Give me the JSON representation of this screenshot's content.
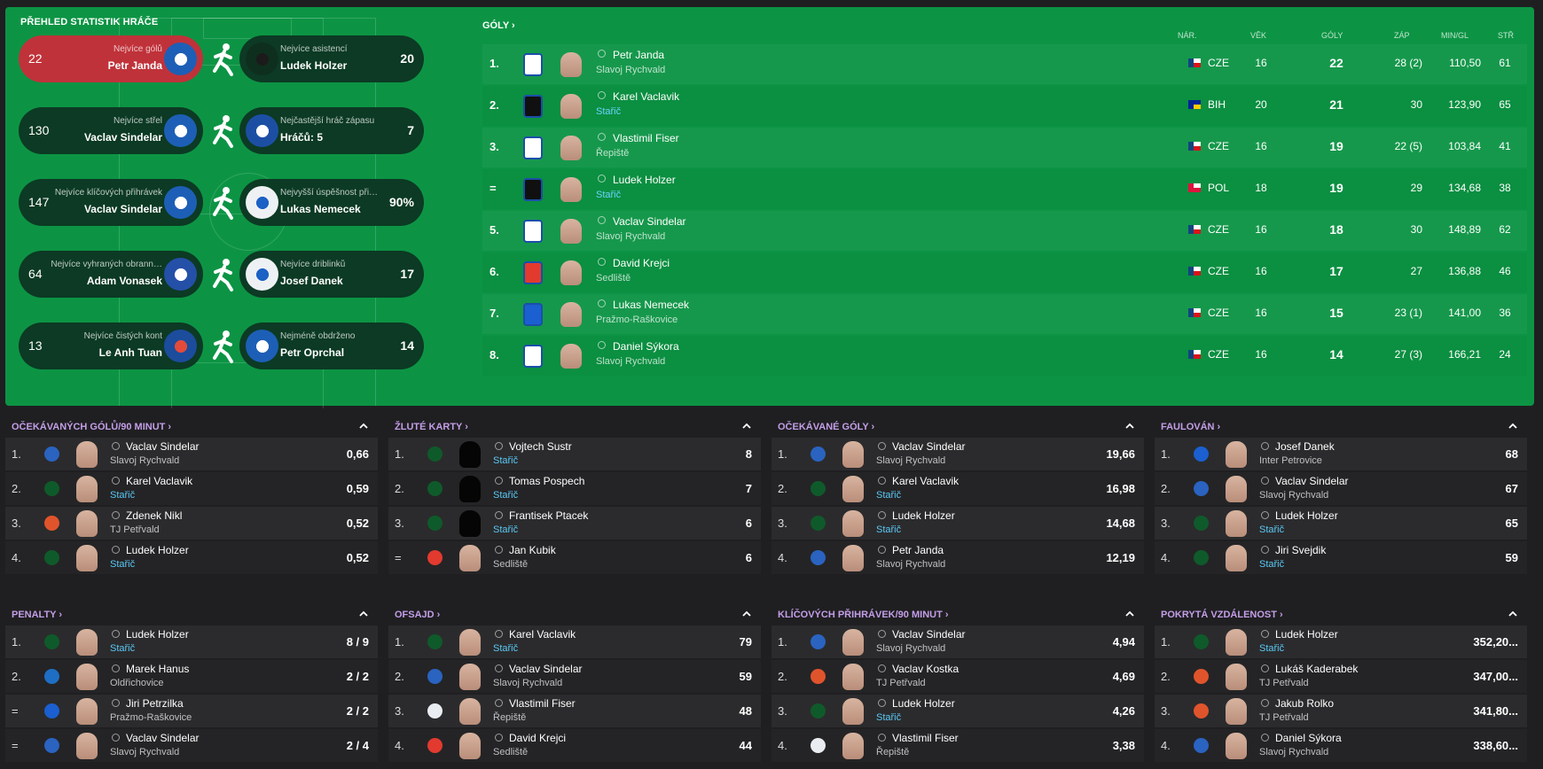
{
  "overview": {
    "title": "PŘEHLED STATISTIK HRÁČE",
    "left": [
      {
        "value": "22",
        "label": "Nejvíce gólů",
        "name": "Petr Janda",
        "highlight": true
      },
      {
        "value": "130",
        "label": "Nejvíce střel",
        "name": "Vaclav Sindelar"
      },
      {
        "value": "147",
        "label": "Nejvíce klíčových přihrávek",
        "name": "Vaclav Sindelar"
      },
      {
        "value": "64",
        "label": "Nejvíce vyhraných obrann…",
        "name": "Adam Vonasek"
      },
      {
        "value": "13",
        "label": "Nejvíce čistých kont",
        "name": "Le Anh Tuan"
      }
    ],
    "right": [
      {
        "value": "20",
        "label": "Nejvíce asistencí",
        "name": "Ludek Holzer"
      },
      {
        "value": "7",
        "label": "Nejčastější hráč zápasu",
        "name": "Hráčů: 5"
      },
      {
        "value": "90%",
        "label": "Nejvyšší úspěšnost při…",
        "name": "Lukas Nemecek"
      },
      {
        "value": "17",
        "label": "Nejvíce driblinků",
        "name": "Josef Danek"
      },
      {
        "value": "14",
        "label": "Nejméně obdrženo",
        "name": "Petr Oprchal"
      }
    ]
  },
  "goals": {
    "title": "GÓLY",
    "headers": {
      "nat": "NÁR.",
      "age": "VĚK",
      "goals": "GÓLY",
      "apps": "ZÁP",
      "mpg": "MIN/GL",
      "shots": "STŘ"
    },
    "rows": [
      {
        "rank": "1.",
        "name": "Petr Janda",
        "team": "Slavoj Rychvald",
        "sub": false,
        "nat": "CZE",
        "age": "16",
        "goals": "22",
        "apps": "28 (2)",
        "mpg": "110,50",
        "shots": "61"
      },
      {
        "rank": "2.",
        "name": "Karel Vaclavik",
        "team": "Stařič",
        "sub": true,
        "nat": "BIH",
        "age": "20",
        "goals": "21",
        "apps": "30",
        "mpg": "123,90",
        "shots": "65"
      },
      {
        "rank": "3.",
        "name": "Vlastimil Fiser",
        "team": "Řepiště",
        "sub": false,
        "nat": "CZE",
        "age": "16",
        "goals": "19",
        "apps": "22 (5)",
        "mpg": "103,84",
        "shots": "41"
      },
      {
        "rank": "=",
        "name": "Ludek Holzer",
        "team": "Stařič",
        "sub": true,
        "nat": "POL",
        "age": "18",
        "goals": "19",
        "apps": "29",
        "mpg": "134,68",
        "shots": "38"
      },
      {
        "rank": "5.",
        "name": "Vaclav Sindelar",
        "team": "Slavoj Rychvald",
        "sub": false,
        "nat": "CZE",
        "age": "16",
        "goals": "18",
        "apps": "30",
        "mpg": "148,89",
        "shots": "62"
      },
      {
        "rank": "6.",
        "name": "David Krejci",
        "team": "Sedliště",
        "sub": false,
        "nat": "CZE",
        "age": "16",
        "goals": "17",
        "apps": "27",
        "mpg": "136,88",
        "shots": "46"
      },
      {
        "rank": "7.",
        "name": "Lukas Nemecek",
        "team": "Pražmo-Raškovice",
        "sub": false,
        "nat": "CZE",
        "age": "16",
        "goals": "15",
        "apps": "23 (1)",
        "mpg": "141,00",
        "shots": "36"
      },
      {
        "rank": "8.",
        "name": "Daniel Sýkora",
        "team": "Slavoj Rychvald",
        "sub": false,
        "nat": "CZE",
        "age": "16",
        "goals": "14",
        "apps": "27 (3)",
        "mpg": "166,21",
        "shots": "24"
      }
    ]
  },
  "cards": [
    {
      "title": "OČEKÁVANÝCH GÓLŮ/90 MINUT",
      "rows": [
        {
          "rank": "1.",
          "name": "Vaclav Sindelar",
          "team": "Slavoj Rychvald",
          "sub": false,
          "value": "0,66"
        },
        {
          "rank": "2.",
          "name": "Karel Vaclavik",
          "team": "Stařič",
          "sub": true,
          "value": "0,59"
        },
        {
          "rank": "3.",
          "name": "Zdenek Nikl",
          "team": "TJ Petřvald",
          "sub": false,
          "value": "0,52"
        },
        {
          "rank": "4.",
          "name": "Ludek Holzer",
          "team": "Stařič",
          "sub": true,
          "value": "0,52"
        }
      ]
    },
    {
      "title": "ŽLUTÉ KARTY",
      "rows": [
        {
          "rank": "1.",
          "name": "Vojtech Sustr",
          "team": "Stařič",
          "sub": true,
          "value": "8"
        },
        {
          "rank": "2.",
          "name": "Tomas Pospech",
          "team": "Stařič",
          "sub": true,
          "value": "7"
        },
        {
          "rank": "3.",
          "name": "Frantisek Ptacek",
          "team": "Stařič",
          "sub": true,
          "value": "6"
        },
        {
          "rank": "=",
          "name": "Jan Kubik",
          "team": "Sedliště",
          "sub": false,
          "value": "6"
        }
      ]
    },
    {
      "title": "OČEKÁVANÉ GÓLY",
      "rows": [
        {
          "rank": "1.",
          "name": "Vaclav Sindelar",
          "team": "Slavoj Rychvald",
          "sub": false,
          "value": "19,66"
        },
        {
          "rank": "2.",
          "name": "Karel Vaclavik",
          "team": "Stařič",
          "sub": true,
          "value": "16,98"
        },
        {
          "rank": "3.",
          "name": "Ludek Holzer",
          "team": "Stařič",
          "sub": true,
          "value": "14,68"
        },
        {
          "rank": "4.",
          "name": "Petr Janda",
          "team": "Slavoj Rychvald",
          "sub": false,
          "value": "12,19"
        }
      ]
    },
    {
      "title": "FAULOVÁN",
      "rows": [
        {
          "rank": "1.",
          "name": "Josef Danek",
          "team": "Inter Petrovice",
          "sub": false,
          "value": "68"
        },
        {
          "rank": "2.",
          "name": "Vaclav Sindelar",
          "team": "Slavoj Rychvald",
          "sub": false,
          "value": "67"
        },
        {
          "rank": "3.",
          "name": "Ludek Holzer",
          "team": "Stařič",
          "sub": true,
          "value": "65"
        },
        {
          "rank": "4.",
          "name": "Jiri Svejdik",
          "team": "Stařič",
          "sub": true,
          "value": "59"
        }
      ]
    },
    {
      "title": "PENALTY",
      "rows": [
        {
          "rank": "1.",
          "name": "Ludek Holzer",
          "team": "Stařič",
          "sub": true,
          "value": "8 / 9"
        },
        {
          "rank": "2.",
          "name": "Marek Hanus",
          "team": "Oldřichovice",
          "sub": false,
          "value": "2 / 2"
        },
        {
          "rank": "=",
          "name": "Jiri Petrzilka",
          "team": "Pražmo-Raškovice",
          "sub": false,
          "value": "2 / 2"
        },
        {
          "rank": "=",
          "name": "Vaclav Sindelar",
          "team": "Slavoj Rychvald",
          "sub": false,
          "value": "2 / 4"
        }
      ]
    },
    {
      "title": "OFSAJD",
      "rows": [
        {
          "rank": "1.",
          "name": "Karel Vaclavik",
          "team": "Stařič",
          "sub": true,
          "value": "79"
        },
        {
          "rank": "2.",
          "name": "Vaclav Sindelar",
          "team": "Slavoj Rychvald",
          "sub": false,
          "value": "59"
        },
        {
          "rank": "3.",
          "name": "Vlastimil Fiser",
          "team": "Řepiště",
          "sub": false,
          "value": "48"
        },
        {
          "rank": "4.",
          "name": "David Krejci",
          "team": "Sedliště",
          "sub": false,
          "value": "44"
        }
      ]
    },
    {
      "title": "KLÍČOVÝCH PŘIHRÁVEK/90 MINUT",
      "rows": [
        {
          "rank": "1.",
          "name": "Vaclav Sindelar",
          "team": "Slavoj Rychvald",
          "sub": false,
          "value": "4,94"
        },
        {
          "rank": "2.",
          "name": "Vaclav Kostka",
          "team": "TJ Petřvald",
          "sub": false,
          "value": "4,69"
        },
        {
          "rank": "3.",
          "name": "Ludek Holzer",
          "team": "Stařič",
          "sub": true,
          "value": "4,26"
        },
        {
          "rank": "4.",
          "name": "Vlastimil Fiser",
          "team": "Řepiště",
          "sub": false,
          "value": "3,38"
        }
      ]
    },
    {
      "title": "POKRYTÁ VZDÁLENOST",
      "rows": [
        {
          "rank": "1.",
          "name": "Ludek Holzer",
          "team": "Stařič",
          "sub": true,
          "value": "352,20..."
        },
        {
          "rank": "2.",
          "name": "Lukáš Kaderabek",
          "team": "TJ Petřvald",
          "sub": false,
          "value": "347,00..."
        },
        {
          "rank": "3.",
          "name": "Jakub Rolko",
          "team": "TJ Petřvald",
          "sub": false,
          "value": "341,80..."
        },
        {
          "rank": "4.",
          "name": "Daniel Sýkora",
          "team": "Slavoj Rychvald",
          "sub": false,
          "value": "338,60..."
        }
      ]
    }
  ],
  "colors": {
    "panel_green": "#0c9444",
    "pill_dark": "#0c3a24",
    "highlight_red": "#c0323a",
    "card_title": "#c49ee8",
    "sub_team": "#5ac8f5"
  }
}
